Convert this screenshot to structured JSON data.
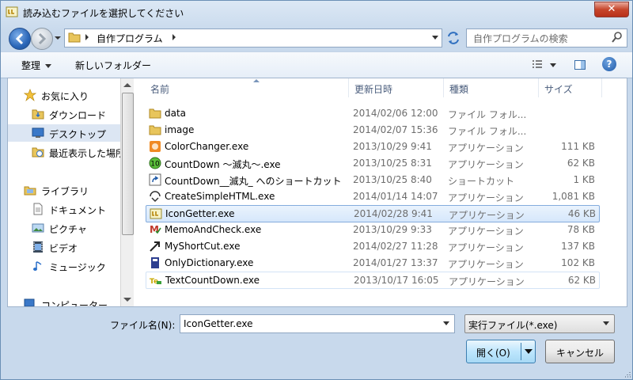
{
  "window": {
    "title": "読み込むファイルを選択してください",
    "close": "✕"
  },
  "address": {
    "path": "自作プログラム",
    "search_placeholder": "自作プログラムの検索"
  },
  "toolbar": {
    "organize": "整理",
    "new_folder": "新しいフォルダー",
    "help": "?"
  },
  "nav": [
    {
      "label": "お気に入り",
      "icon": "star-icon"
    },
    {
      "label": "ダウンロード",
      "icon": "download-folder-icon"
    },
    {
      "label": "デスクトップ",
      "icon": "desktop-icon"
    },
    {
      "label": "最近表示した場所",
      "icon": "recent-places-icon"
    },
    {
      "label": "ライブラリ",
      "icon": "library-icon"
    },
    {
      "label": "ドキュメント",
      "icon": "documents-icon"
    },
    {
      "label": "ピクチャ",
      "icon": "pictures-icon"
    },
    {
      "label": "ビデオ",
      "icon": "videos-icon"
    },
    {
      "label": "ミュージック",
      "icon": "music-icon"
    },
    {
      "label": "コンピューター",
      "icon": "computer-icon"
    }
  ],
  "columns": {
    "name": "名前",
    "date": "更新日時",
    "type": "種類",
    "size": "サイズ"
  },
  "files": [
    {
      "name": "data",
      "date": "2014/02/06 12:00",
      "type": "ファイル フォル...",
      "size": ""
    },
    {
      "name": "image",
      "date": "2014/02/07 15:36",
      "type": "ファイル フォル...",
      "size": ""
    },
    {
      "name": "ColorChanger.exe",
      "date": "2013/10/29 9:41",
      "type": "アプリケーション",
      "size": "111 KB"
    },
    {
      "name": "CountDown ～滅丸～.exe",
      "date": "2013/10/25 8:31",
      "type": "アプリケーション",
      "size": "62 KB"
    },
    {
      "name": "CountDown__滅丸_ へのショートカット",
      "date": "2013/10/25 8:40",
      "type": "ショートカット",
      "size": "1 KB"
    },
    {
      "name": "CreateSimpleHTML.exe",
      "date": "2014/01/14 14:07",
      "type": "アプリケーション",
      "size": "1,081 KB"
    },
    {
      "name": "IconGetter.exe",
      "date": "2014/02/28 9:41",
      "type": "アプリケーション",
      "size": "46 KB"
    },
    {
      "name": "MemoAndCheck.exe",
      "date": "2013/10/29 9:33",
      "type": "アプリケーション",
      "size": "78 KB"
    },
    {
      "name": "MyShortCut.exe",
      "date": "2014/02/27 11:28",
      "type": "アプリケーション",
      "size": "137 KB"
    },
    {
      "name": "OnlyDictionary.exe",
      "date": "2014/01/27 13:37",
      "type": "アプリケーション",
      "size": "102 KB"
    },
    {
      "name": "TextCountDown.exe",
      "date": "2013/10/17 16:05",
      "type": "アプリケーション",
      "size": "62 KB"
    }
  ],
  "footer": {
    "filename_label": "ファイル名(N):",
    "filename_value": "IconGetter.exe",
    "filetype_value": "実行ファイル(*.exe)",
    "open_label": "開く(O)",
    "cancel_label": "キャンセル"
  },
  "colors": {
    "selection": "#d6e7fb",
    "selection_border": "#84acdd",
    "accent": "#2a66b8"
  }
}
